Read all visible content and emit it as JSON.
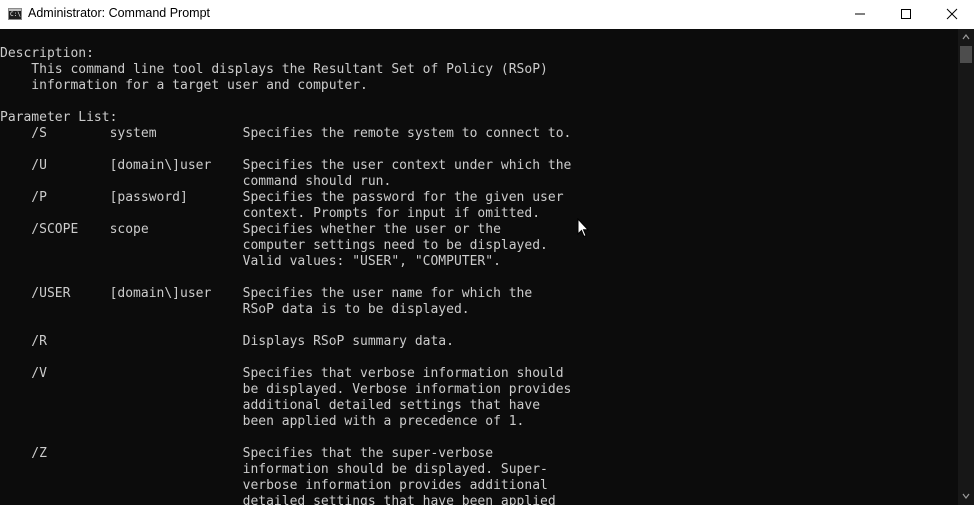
{
  "window": {
    "title": "Administrator: Command Prompt",
    "icon": "cmd-app-icon",
    "icon_text": "C:\\.",
    "controls": [
      "minimize-icon",
      "maximize-icon",
      "close-icon"
    ]
  },
  "console": {
    "lines": [
      "",
      "Description:",
      "    This command line tool displays the Resultant Set of Policy (RSoP)",
      "    information for a target user and computer.",
      "",
      "Parameter List:",
      "    /S        system           Specifies the remote system to connect to.",
      "",
      "    /U        [domain\\]user    Specifies the user context under which the",
      "                               command should run.",
      "    /P        [password]       Specifies the password for the given user",
      "                               context. Prompts for input if omitted.",
      "    /SCOPE    scope            Specifies whether the user or the",
      "                               computer settings need to be displayed.",
      "                               Valid values: \"USER\", \"COMPUTER\".",
      "",
      "    /USER     [domain\\]user    Specifies the user name for which the",
      "                               RSoP data is to be displayed.",
      "",
      "    /R                         Displays RSoP summary data.",
      "",
      "    /V                         Specifies that verbose information should",
      "                               be displayed. Verbose information provides",
      "                               additional detailed settings that have",
      "                               been applied with a precedence of 1.",
      "",
      "    /Z                         Specifies that the super-verbose",
      "                               information should be displayed. Super-",
      "                               verbose information provides additional",
      "                               detailed settings that have been applied"
    ]
  },
  "colors": {
    "background": "#0c0c0c",
    "text": "#cccccc",
    "titlebar": "#ffffff"
  }
}
